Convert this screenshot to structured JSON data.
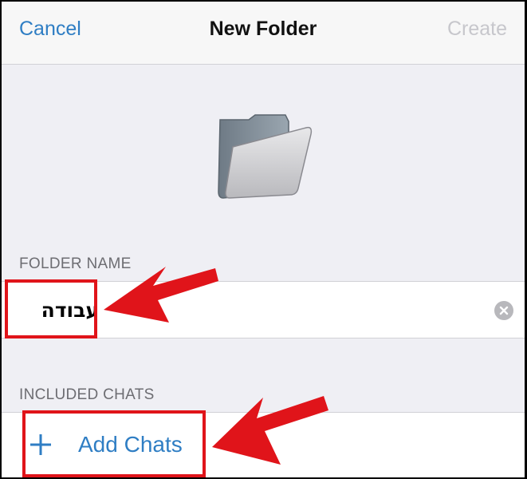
{
  "navbar": {
    "cancel_label": "Cancel",
    "title": "New Folder",
    "create_label": "Create"
  },
  "folder_name_section": {
    "header": "FOLDER NAME",
    "value": "עבודה"
  },
  "included_chats_section": {
    "header": "INCLUDED CHATS",
    "add_label": "Add Chats"
  },
  "colors": {
    "accent": "#2f7ec4",
    "disabled": "#c7c7cc",
    "annotation_red": "#e0141a",
    "background": "#efeff4"
  },
  "icons": [
    "folder-icon",
    "clear-icon",
    "plus-icon",
    "arrow-annotation-icon"
  ]
}
